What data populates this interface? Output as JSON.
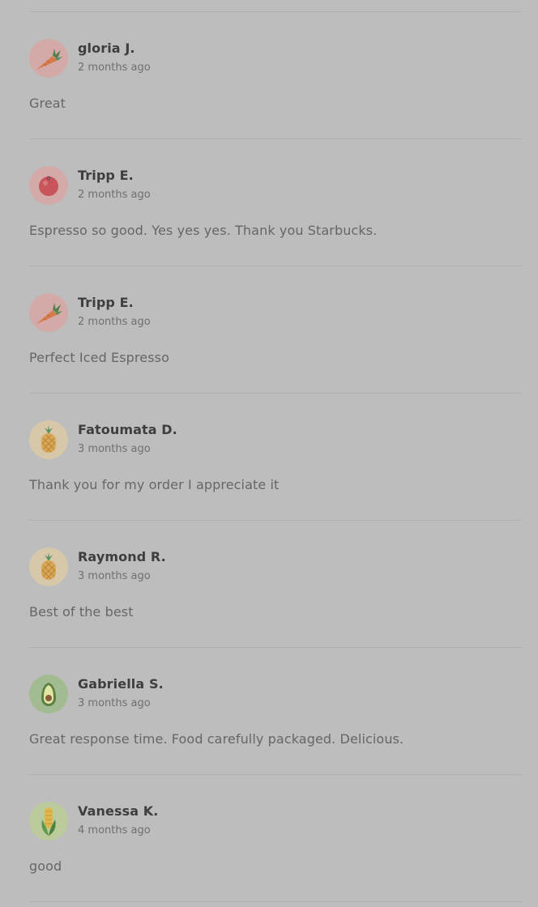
{
  "reviews": [
    {
      "name": "gloria J.",
      "time": "2 months ago",
      "text": "Great",
      "avatar_icon": "carrot-icon"
    },
    {
      "name": "Tripp E.",
      "time": "2 months ago",
      "text": "Espresso so good. Yes yes yes. Thank you Starbucks.",
      "avatar_icon": "tomato-icon"
    },
    {
      "name": "Tripp E.",
      "time": "2 months ago",
      "text": "Perfect Iced Espresso",
      "avatar_icon": "carrot-icon"
    },
    {
      "name": "Fatoumata D.",
      "time": "3 months ago",
      "text": "Thank you for my order I appreciate it",
      "avatar_icon": "pineapple-icon"
    },
    {
      "name": "Raymond R.",
      "time": "3 months ago",
      "text": "Best of the best",
      "avatar_icon": "pineapple-icon"
    },
    {
      "name": "Gabriella S.",
      "time": "3 months ago",
      "text": "Great response time. Food carefully packaged. Delicious.",
      "avatar_icon": "avocado-icon"
    },
    {
      "name": "Vanessa K.",
      "time": "4 months ago",
      "text": "good",
      "avatar_icon": "corn-icon"
    }
  ],
  "avatar_colors": {
    "carrot-icon": "#d3aaa8",
    "tomato-icon": "#d3aaa8",
    "pineapple-icon": "#d8c8aa",
    "avocado-icon": "#a3bb91",
    "corn-icon": "#bccb9c"
  }
}
